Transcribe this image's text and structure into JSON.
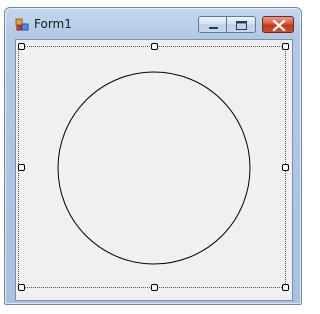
{
  "window": {
    "title": "Form1"
  },
  "titlebar_buttons": {
    "minimize_icon": "minimize-icon",
    "maximize_icon": "maximize-icon",
    "close_icon": "close-icon"
  },
  "colors": {
    "close_button": "#c7391f",
    "client_background": "#f0f0f0",
    "frame": "#b2c9e6"
  },
  "designer": {
    "shape": "circle",
    "selection_style": "dotted"
  }
}
